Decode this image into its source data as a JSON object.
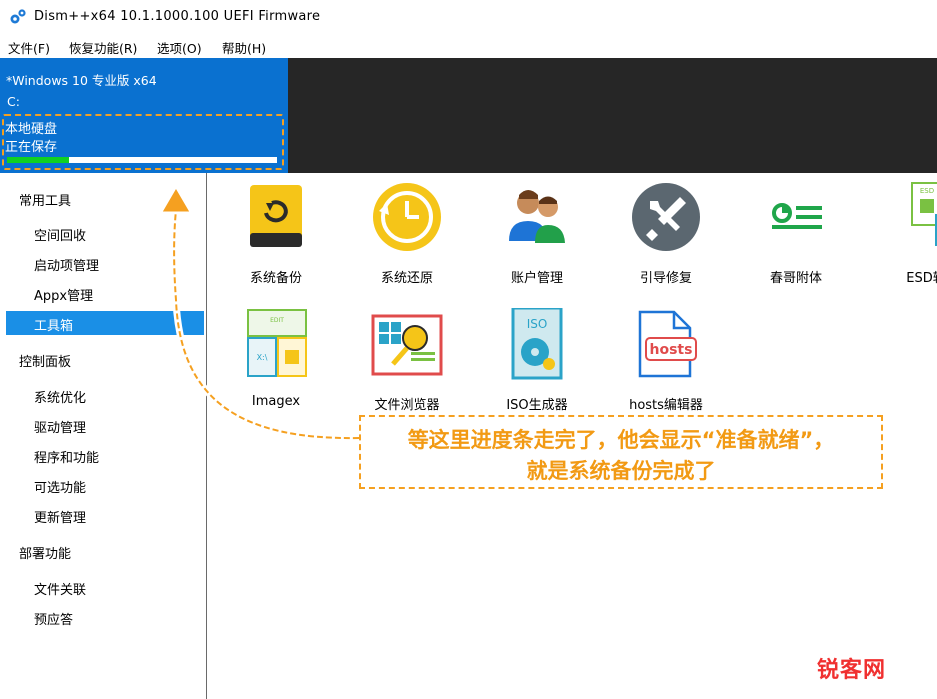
{
  "window": {
    "title": "Dism++x64 10.1.1000.100 UEFI Firmware",
    "icon": "gear-icon"
  },
  "menubar": {
    "items": [
      "文件(F)",
      "恢复功能(R)",
      "选项(O)",
      "帮助(H)"
    ]
  },
  "session": {
    "os": "*Windows 10 专业版 x64",
    "drive": "C:",
    "disk_label": "本地硬盘",
    "status": "正在保存",
    "progress": 0.23,
    "accent_color": "#0a71d0",
    "progress_color": "#10d023"
  },
  "sidebar": {
    "categories": [
      {
        "label": "常用工具",
        "items": [
          "空间回收",
          "启动项管理",
          "Appx管理",
          "工具箱"
        ]
      },
      {
        "label": "控制面板",
        "items": [
          "系统优化",
          "驱动管理",
          "程序和功能",
          "可选功能",
          "更新管理"
        ]
      },
      {
        "label": "部署功能",
        "items": [
          "文件关联",
          "预应答"
        ]
      }
    ],
    "selected": "工具箱"
  },
  "tools": {
    "row1": [
      {
        "label": "系统备份",
        "icon": "backup-drive-icon"
      },
      {
        "label": "系统还原",
        "icon": "restore-clock-icon"
      },
      {
        "label": "账户管理",
        "icon": "users-icon"
      },
      {
        "label": "引导修复",
        "icon": "wrench-screwdriver-icon"
      },
      {
        "label": "春哥附体",
        "icon": "toggle-list-icon"
      },
      {
        "label": "ESD转",
        "icon": "esd-convert-icon"
      }
    ],
    "row2": [
      {
        "label": "Imagex",
        "icon": "imagex-icon"
      },
      {
        "label": "文件浏览器",
        "icon": "file-browser-icon"
      },
      {
        "label": "ISO生成器",
        "icon": "iso-disc-icon"
      },
      {
        "label": "hosts编辑器",
        "icon": "hosts-file-icon"
      }
    ],
    "iso_text": "ISO",
    "hosts_text": "hosts",
    "esd_text": "ESD",
    "edit_text": "EDIT",
    "drive_text": "X:\\"
  },
  "callout": {
    "line1": "等这里进度条走完了，他会显示“准备就绪”，",
    "line2": "就是系统备份完成了",
    "color": "#f29a14"
  },
  "watermark": {
    "text": "锐客网"
  }
}
